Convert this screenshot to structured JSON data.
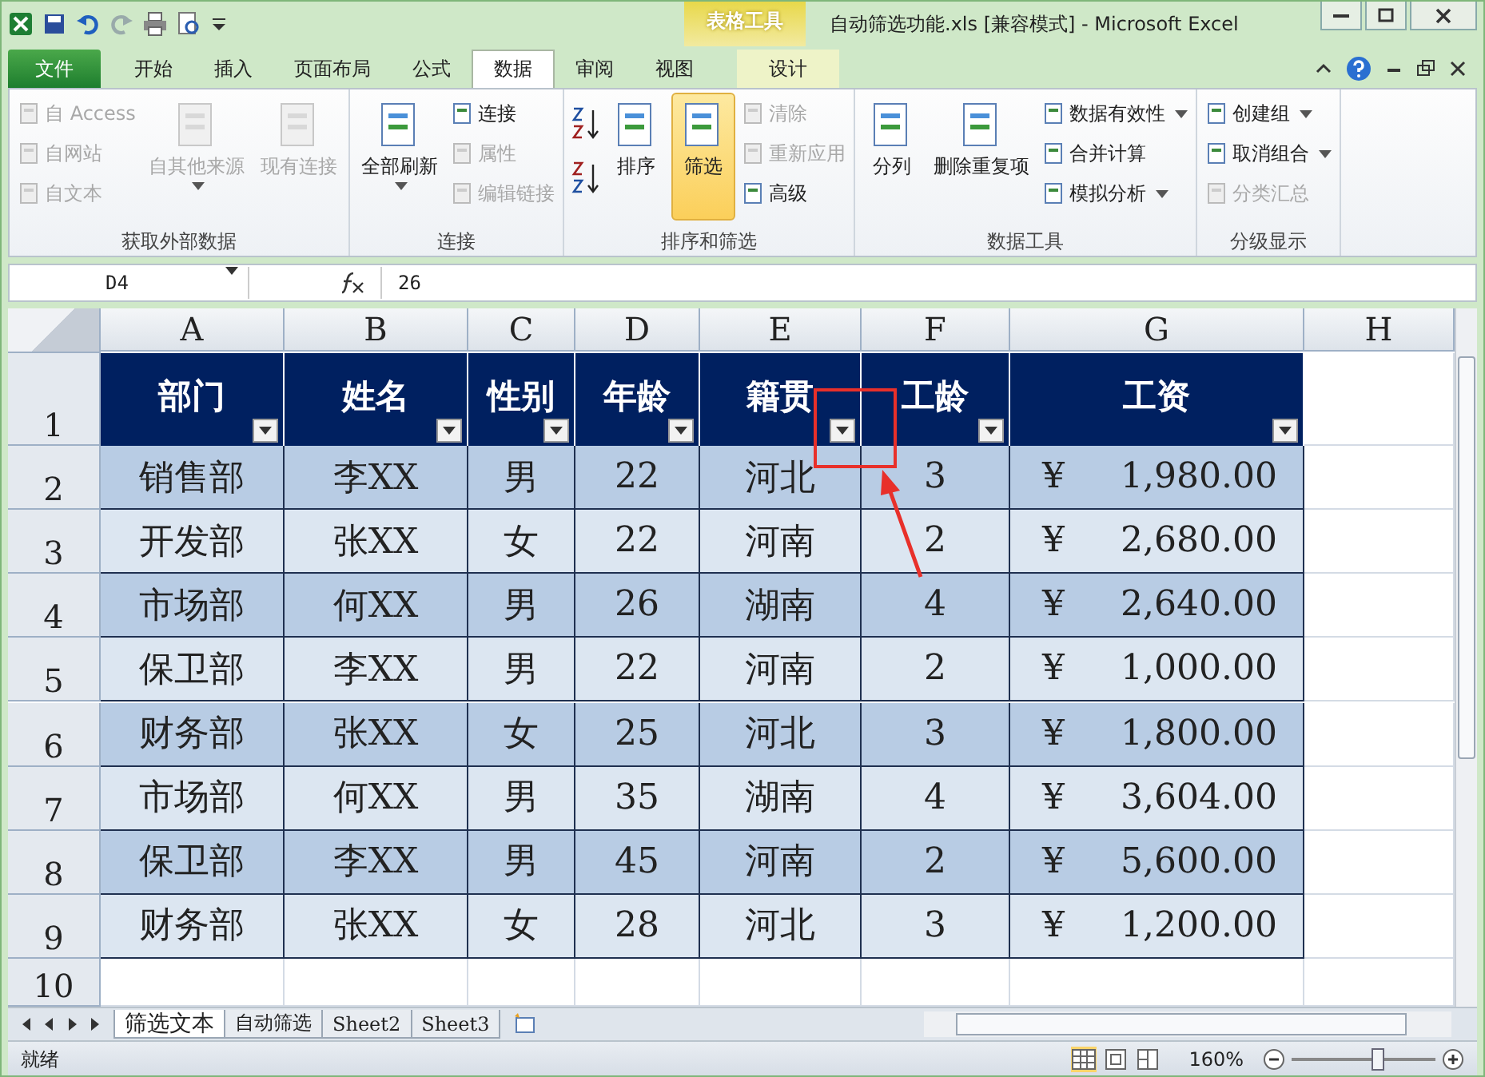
{
  "title_bar": {
    "contextual_group": "表格工具",
    "title": "自动筛选功能.xls  [兼容模式]  -  Microsoft Excel"
  },
  "ribbon_tabs": [
    {
      "label": "文件",
      "kind": "file",
      "selected": false
    },
    {
      "label": "开始",
      "kind": "normal",
      "selected": false
    },
    {
      "label": "插入",
      "kind": "normal",
      "selected": false
    },
    {
      "label": "页面布局",
      "kind": "normal",
      "selected": false
    },
    {
      "label": "公式",
      "kind": "normal",
      "selected": false
    },
    {
      "label": "数据",
      "kind": "normal",
      "selected": true
    },
    {
      "label": "审阅",
      "kind": "normal",
      "selected": false
    },
    {
      "label": "视图",
      "kind": "normal",
      "selected": false
    },
    {
      "label": "设计",
      "kind": "contextual",
      "selected": false
    }
  ],
  "ribbon_groups": [
    {
      "label": "获取外部数据",
      "columns": [
        {
          "kind": "stack",
          "items": [
            {
              "label": "自 Access",
              "disabled": true,
              "dropdown": false
            },
            {
              "label": "自网站",
              "disabled": true,
              "dropdown": false
            },
            {
              "label": "自文本",
              "disabled": true,
              "dropdown": false
            }
          ]
        },
        {
          "kind": "large",
          "label": "自其他来源",
          "disabled": true,
          "dropdown": true,
          "selected": false
        },
        {
          "kind": "large",
          "label": "现有连接",
          "disabled": true,
          "dropdown": false,
          "selected": false
        }
      ]
    },
    {
      "label": "连接",
      "columns": [
        {
          "kind": "large",
          "label": "全部刷新",
          "disabled": false,
          "dropdown": true,
          "selected": false
        },
        {
          "kind": "stack",
          "items": [
            {
              "label": "连接",
              "disabled": false,
              "dropdown": false
            },
            {
              "label": "属性",
              "disabled": true,
              "dropdown": false
            },
            {
              "label": "编辑链接",
              "disabled": true,
              "dropdown": false
            }
          ]
        }
      ]
    },
    {
      "label": "排序和筛选",
      "columns": [
        {
          "kind": "sort"
        },
        {
          "kind": "large",
          "label": "排序",
          "disabled": false,
          "dropdown": false,
          "selected": false
        },
        {
          "kind": "large",
          "label": "筛选",
          "disabled": false,
          "dropdown": false,
          "selected": true
        },
        {
          "kind": "stack",
          "items": [
            {
              "label": "清除",
              "disabled": true,
              "dropdown": false
            },
            {
              "label": "重新应用",
              "disabled": true,
              "dropdown": false
            },
            {
              "label": "高级",
              "disabled": false,
              "dropdown": false
            }
          ]
        }
      ]
    },
    {
      "label": "数据工具",
      "columns": [
        {
          "kind": "large",
          "label": "分列",
          "disabled": false,
          "dropdown": false,
          "selected": false
        },
        {
          "kind": "large",
          "label": "删除重复项",
          "disabled": false,
          "dropdown": false,
          "selected": false
        },
        {
          "kind": "stack",
          "items": [
            {
              "label": "数据有效性",
              "disabled": false,
              "dropdown": true
            },
            {
              "label": "合并计算",
              "disabled": false,
              "dropdown": false
            },
            {
              "label": "模拟分析",
              "disabled": false,
              "dropdown": true
            }
          ]
        }
      ]
    },
    {
      "label": "分级显示",
      "columns": [
        {
          "kind": "stack",
          "items": [
            {
              "label": "创建组",
              "disabled": false,
              "dropdown": true
            },
            {
              "label": "取消组合",
              "disabled": false,
              "dropdown": true
            },
            {
              "label": "分类汇总",
              "disabled": true,
              "dropdown": false
            }
          ]
        }
      ]
    }
  ],
  "formula_bar": {
    "name_box": "D4",
    "formula": "26"
  },
  "column_headers": [
    "A",
    "B",
    "C",
    "D",
    "E",
    "F",
    "G",
    "H"
  ],
  "row_numbers": [
    "1",
    "2",
    "3",
    "4",
    "5",
    "6",
    "7",
    "8",
    "9",
    "10"
  ],
  "table": {
    "headers": [
      "部门",
      "姓名",
      "性别",
      "年龄",
      "籍贯",
      "工龄",
      "工资"
    ],
    "rows": [
      {
        "cells": [
          "销售部",
          "李XX",
          "男",
          "22",
          "河北",
          "3"
        ],
        "currency": "¥",
        "amount": "1,980.00"
      },
      {
        "cells": [
          "开发部",
          "张XX",
          "女",
          "22",
          "河南",
          "2"
        ],
        "currency": "¥",
        "amount": "2,680.00"
      },
      {
        "cells": [
          "市场部",
          "何XX",
          "男",
          "26",
          "湖南",
          "4"
        ],
        "currency": "¥",
        "amount": "2,640.00"
      },
      {
        "cells": [
          "保卫部",
          "李XX",
          "男",
          "22",
          "河南",
          "2"
        ],
        "currency": "¥",
        "amount": "1,000.00"
      },
      {
        "cells": [
          "财务部",
          "张XX",
          "女",
          "25",
          "河北",
          "3"
        ],
        "currency": "¥",
        "amount": "1,800.00"
      },
      {
        "cells": [
          "市场部",
          "何XX",
          "男",
          "35",
          "湖南",
          "4"
        ],
        "currency": "¥",
        "amount": "3,604.00"
      },
      {
        "cells": [
          "保卫部",
          "李XX",
          "男",
          "45",
          "河南",
          "2"
        ],
        "currency": "¥",
        "amount": "5,600.00"
      },
      {
        "cells": [
          "财务部",
          "张XX",
          "女",
          "28",
          "河北",
          "3"
        ],
        "currency": "¥",
        "amount": "1,200.00"
      }
    ]
  },
  "sheet_tabs": [
    {
      "label": "筛选文本",
      "selected": true
    },
    {
      "label": "自动筛选",
      "selected": false
    },
    {
      "label": "Sheet2",
      "selected": false
    },
    {
      "label": "Sheet3",
      "selected": false
    }
  ],
  "status_bar": {
    "status": "就绪",
    "zoom": "160%",
    "zoom_slider": {
      "level": 0.6
    }
  }
}
